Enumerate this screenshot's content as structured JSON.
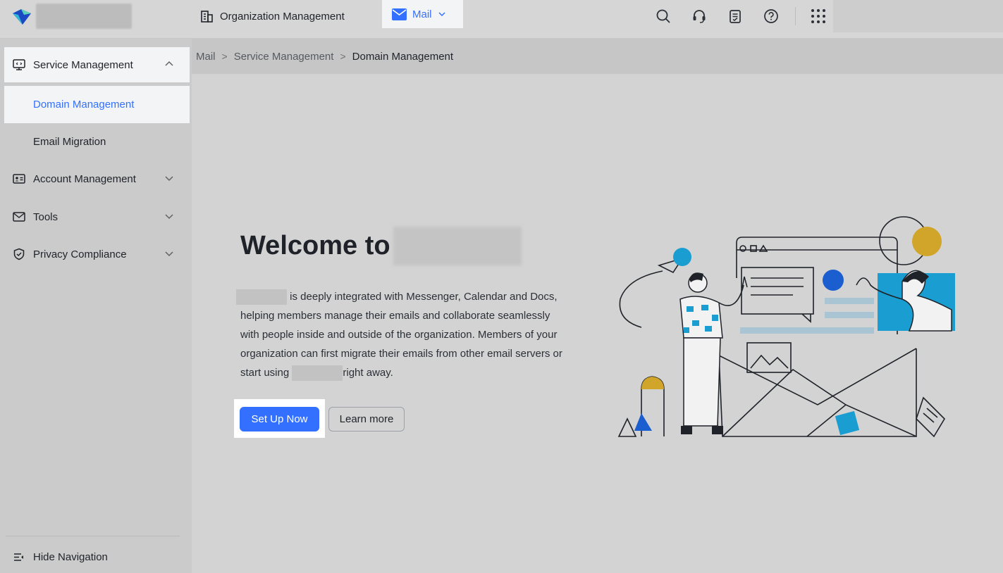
{
  "topbar": {
    "org_nav_label": "Organization Management",
    "mail_nav_label": "Mail",
    "icons": [
      "search-icon",
      "headset-icon",
      "clipboard-icon",
      "help-icon",
      "apps-grid-icon"
    ]
  },
  "sidebar": {
    "service_management": "Service Management",
    "domain_management": "Domain Management",
    "email_migration": "Email Migration",
    "account_management": "Account Management",
    "tools": "Tools",
    "privacy_compliance": "Privacy Compliance",
    "hide_navigation": "Hide Navigation"
  },
  "breadcrumb": {
    "items": [
      "Mail",
      "Service Management",
      "Domain Management"
    ],
    "separator": ">"
  },
  "main": {
    "welcome_title": "Welcome to",
    "desc_part1": "is deeply integrated with Messenger, Calendar and Docs, helping members manage their emails and collaborate seamlessly with people inside and outside of the organization. Members of your organization can first migrate their emails from other email servers or start using",
    "desc_part2": "right away.",
    "setup_button": "Set Up Now",
    "learn_more_button": "Learn more"
  },
  "colors": {
    "accent": "#3370ff",
    "page_background": "#d3d3d3",
    "sidebar_background": "#cbcbcb",
    "active_item_background": "#f3f4f6"
  }
}
